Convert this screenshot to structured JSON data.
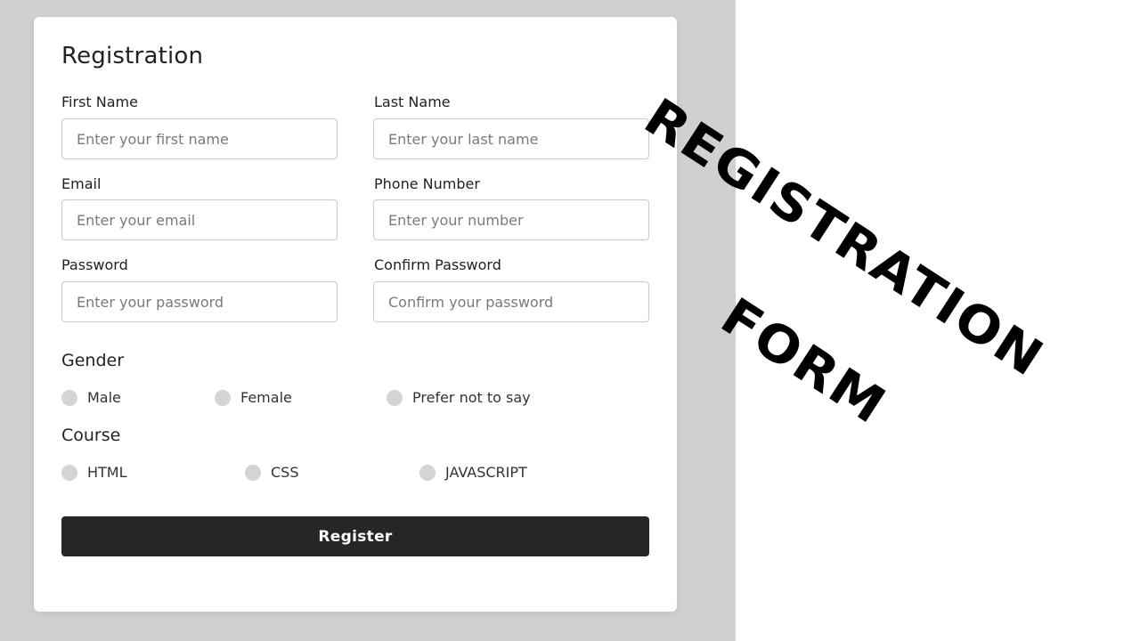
{
  "form": {
    "title": "Registration",
    "fields": {
      "first_name": {
        "label": "First Name",
        "placeholder": "Enter your first name"
      },
      "last_name": {
        "label": "Last Name",
        "placeholder": "Enter your last name"
      },
      "email": {
        "label": "Email",
        "placeholder": "Enter your email"
      },
      "phone": {
        "label": "Phone Number",
        "placeholder": "Enter your number"
      },
      "password": {
        "label": "Password",
        "placeholder": "Enter your password"
      },
      "confirm_password": {
        "label": "Confirm Password",
        "placeholder": "Confirm your password"
      }
    },
    "gender": {
      "title": "Gender",
      "options": [
        "Male",
        "Female",
        "Prefer not to say"
      ]
    },
    "course": {
      "title": "Course",
      "options": [
        "HTML",
        "CSS",
        "JAVASCRIPT"
      ]
    },
    "submit_label": "Register"
  },
  "decor": {
    "line1": "REGISTRATION",
    "line2": "FORM"
  },
  "colors": {
    "backdrop": "#d1cfd0",
    "button": "#262626",
    "radio": "#d4d4d4"
  }
}
